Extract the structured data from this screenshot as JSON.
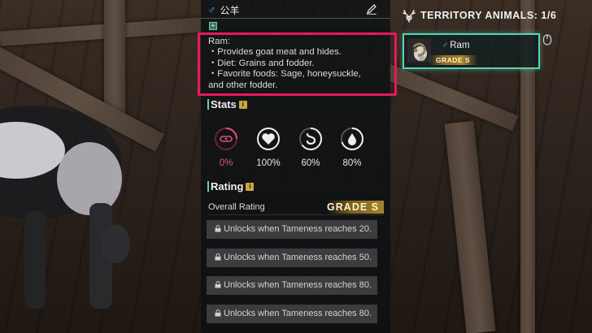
{
  "panel": {
    "species_name": "公羊",
    "description": {
      "title": "Ram:",
      "lines": [
        "・Provides goat meat and hides.",
        "・Diet: Grains and fodder.",
        "・Favorite foods: Sage, honeysuckle,",
        "and other fodder."
      ]
    },
    "stats_title": "Stats",
    "stats": [
      {
        "icon": "collar-icon",
        "value": "0%",
        "color": "#e0507a"
      },
      {
        "icon": "heart-icon",
        "value": "100%",
        "color": "#e6e6e6"
      },
      {
        "icon": "stomach-icon",
        "value": "60%",
        "color": "#e6e6e6"
      },
      {
        "icon": "water-drop-icon",
        "value": "80%",
        "color": "#e6e6e6"
      }
    ],
    "rating_title": "Rating",
    "overall_rating_label": "Overall Rating",
    "overall_grade": "GRADE S",
    "locked_rows": [
      "Unlocks when Tameness reaches 20.",
      "Unlocks when Tameness reaches 50.",
      "Unlocks when Tameness reaches 80.",
      "Unlocks when Tameness reaches 80."
    ]
  },
  "territory": {
    "title": "TERRITORY ANIMALS: 1/6",
    "animals": [
      {
        "name": "Ram",
        "grade": "GRADE S",
        "selected": true
      }
    ]
  },
  "colors": {
    "accent_teal": "#55d4b4",
    "highlight_box": "#e8195a",
    "male_symbol": "#38b6f0",
    "grade_gold": "#a9832c"
  }
}
